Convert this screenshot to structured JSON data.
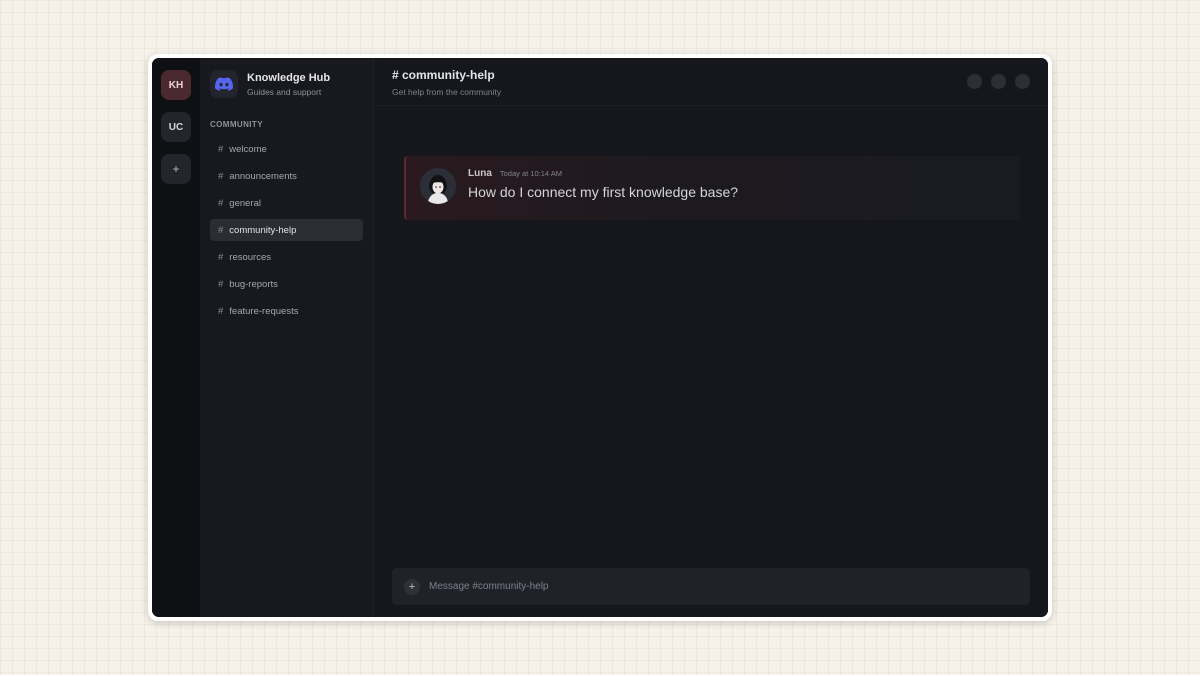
{
  "servers": [
    {
      "label": "KH",
      "active": true
    },
    {
      "label": "UC",
      "active": false
    },
    {
      "label": "+",
      "active": false
    }
  ],
  "hub": {
    "name": "Knowledge Hub",
    "subtitle": "Guides and support",
    "logo_icon": "discord-icon"
  },
  "sidebar": {
    "category": "COMMUNITY",
    "channels": [
      {
        "label": "welcome"
      },
      {
        "label": "announcements"
      },
      {
        "label": "general"
      },
      {
        "label": "community-help",
        "active": true
      },
      {
        "label": "resources"
      },
      {
        "label": "bug-reports"
      },
      {
        "label": "feature-requests"
      }
    ]
  },
  "header": {
    "title": "# community-help",
    "subtitle": "Get help from the community"
  },
  "message": {
    "author": "Luna",
    "time": "Today at 10:14 AM",
    "text": "How do I connect my first knowledge base?"
  },
  "composer": {
    "placeholder": "Message #community-help",
    "plus_label": "+"
  },
  "colors": {
    "accent": "#5865f2",
    "active_server": "#4a2a30",
    "message_border": "#5a2a31"
  }
}
